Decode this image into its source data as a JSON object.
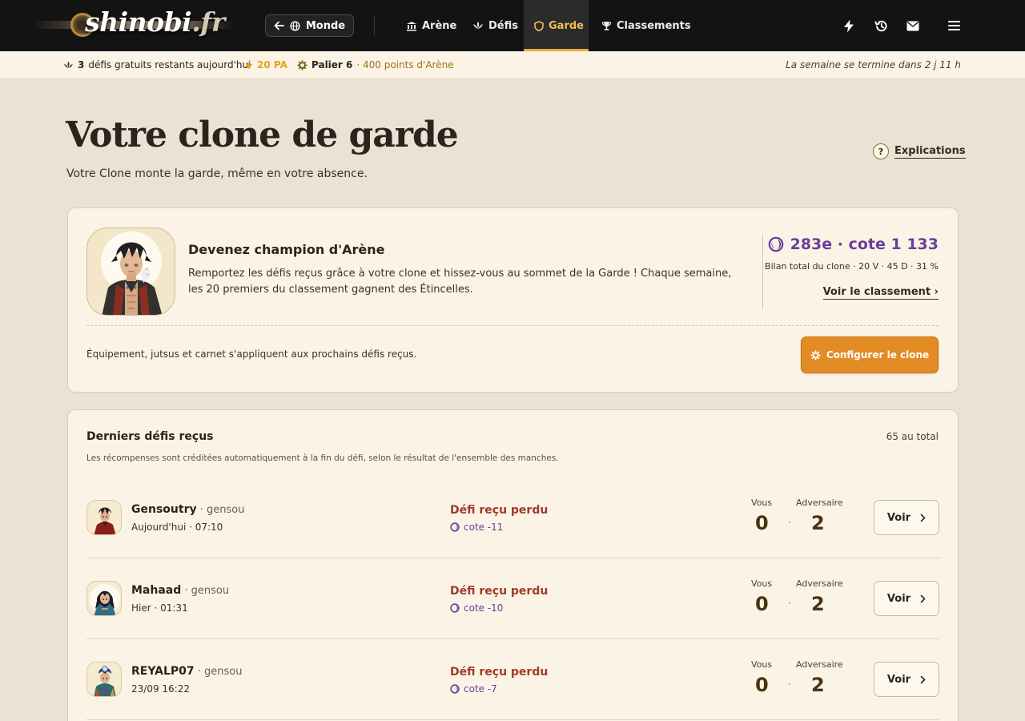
{
  "nav": {
    "logo_main": "shinobi",
    "logo_suffix": ".fr",
    "monde_label": "Monde",
    "tabs": [
      {
        "label": "Arène",
        "icon": "arena-icon"
      },
      {
        "label": "Défis",
        "icon": "lotus-icon"
      },
      {
        "label": "Garde",
        "icon": "shield-icon"
      },
      {
        "label": "Classements",
        "icon": "trophy-icon"
      }
    ],
    "active_tab": "Garde",
    "right_icons": [
      "lightning-icon",
      "history-icon",
      "mail-icon",
      "menu-icon"
    ]
  },
  "subbar": {
    "free_count": "3",
    "free_text": "défis gratuits restants aujourd'hui",
    "pa": "20 PA",
    "palier": "Palier 6",
    "palier_points": "· 400 points d'Arène",
    "week_end": "La semaine se termine dans 2 j 11 h"
  },
  "header": {
    "title": "Votre clone de garde",
    "subtitle": "Votre Clone monte la garde, même en votre absence.",
    "help_symbol": "?",
    "help_label": "Explications"
  },
  "champion": {
    "title": "Devenez champion d'Arène",
    "text": "Remportez les défis reçus grâce à votre clone et hissez-vous au sommet de la Garde ! Chaque semaine, les 20 premiers du classement gagnent des Étincelles.",
    "rank": "283e · cote 1 133",
    "stats": "Bilan total du clone · 20 V · 45 D · 31 %",
    "rank_link": "Voir le classement ›",
    "equip_text": "Équipement, jutsus et carnet s'appliquent aux prochains défis reçus.",
    "config_label": "Configurer le clone"
  },
  "received": {
    "title": "Derniers défis reçus",
    "total": "65 au total",
    "note": "Les récompenses sont créditées automatiquement à la fin du défi, selon le résultat de l'ensemble des manches.",
    "you_label": "Vous",
    "opp_label": "Adversaire",
    "voir_label": "Voir",
    "rows": [
      {
        "name": "Gensoutry",
        "tag": "· gensou",
        "date": "Aujourd'hui · 07:10",
        "result": "Défi reçu perdu",
        "cote": "cote -11",
        "you": "0",
        "sep": "·",
        "opp": "2"
      },
      {
        "name": "Mahaad",
        "tag": "· gensou",
        "date": "Hier · 01:31",
        "result": "Défi reçu perdu",
        "cote": "cote -10",
        "you": "0",
        "sep": "·",
        "opp": "2"
      },
      {
        "name": "REYALP07",
        "tag": "· gensou",
        "date": "23/09 16:22",
        "result": "Défi reçu perdu",
        "cote": "cote -7",
        "you": "0",
        "sep": "·",
        "opp": "2"
      }
    ]
  },
  "colors": {
    "accent": "#e38b24",
    "active_tab": "#f0bd52",
    "loss": "#a23a2a",
    "cote": "#6a3d9a"
  }
}
